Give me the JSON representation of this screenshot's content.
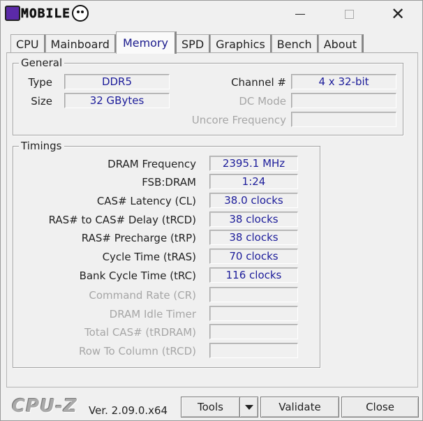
{
  "window": {
    "logo_text": "MOBILE"
  },
  "tabs": [
    "CPU",
    "Mainboard",
    "Memory",
    "SPD",
    "Graphics",
    "Bench",
    "About"
  ],
  "active_tab": "Memory",
  "general": {
    "title": "General",
    "type_label": "Type",
    "type_value": "DDR5",
    "size_label": "Size",
    "size_value": "32 GBytes",
    "channel_label": "Channel #",
    "channel_value": "4 x 32-bit",
    "dcmode_label": "DC Mode",
    "dcmode_value": "",
    "uncore_label": "Uncore Frequency",
    "uncore_value": ""
  },
  "timings": {
    "title": "Timings",
    "rows": [
      {
        "label": "DRAM Frequency",
        "value": "2395.1 MHz",
        "enabled": true
      },
      {
        "label": "FSB:DRAM",
        "value": "1:24",
        "enabled": true
      },
      {
        "label": "CAS# Latency (CL)",
        "value": "38.0 clocks",
        "enabled": true
      },
      {
        "label": "RAS# to CAS# Delay (tRCD)",
        "value": "38 clocks",
        "enabled": true
      },
      {
        "label": "RAS# Precharge (tRP)",
        "value": "38 clocks",
        "enabled": true
      },
      {
        "label": "Cycle Time (tRAS)",
        "value": "70 clocks",
        "enabled": true
      },
      {
        "label": "Bank Cycle Time (tRC)",
        "value": "116 clocks",
        "enabled": true
      },
      {
        "label": "Command Rate (CR)",
        "value": "",
        "enabled": false
      },
      {
        "label": "DRAM Idle Timer",
        "value": "",
        "enabled": false
      },
      {
        "label": "Total CAS# (tRDRAM)",
        "value": "",
        "enabled": false
      },
      {
        "label": "Row To Column (tRCD)",
        "value": "",
        "enabled": false
      }
    ]
  },
  "footer": {
    "brand": "CPU-Z",
    "version": "Ver. 2.09.0.x64",
    "tools_label": "Tools",
    "validate_label": "Validate",
    "close_label": "Close"
  },
  "colors": {
    "value_text": "#1c1c9a",
    "active_tab_text": "#1a1a8c",
    "disabled_label": "#a6a6a6"
  }
}
